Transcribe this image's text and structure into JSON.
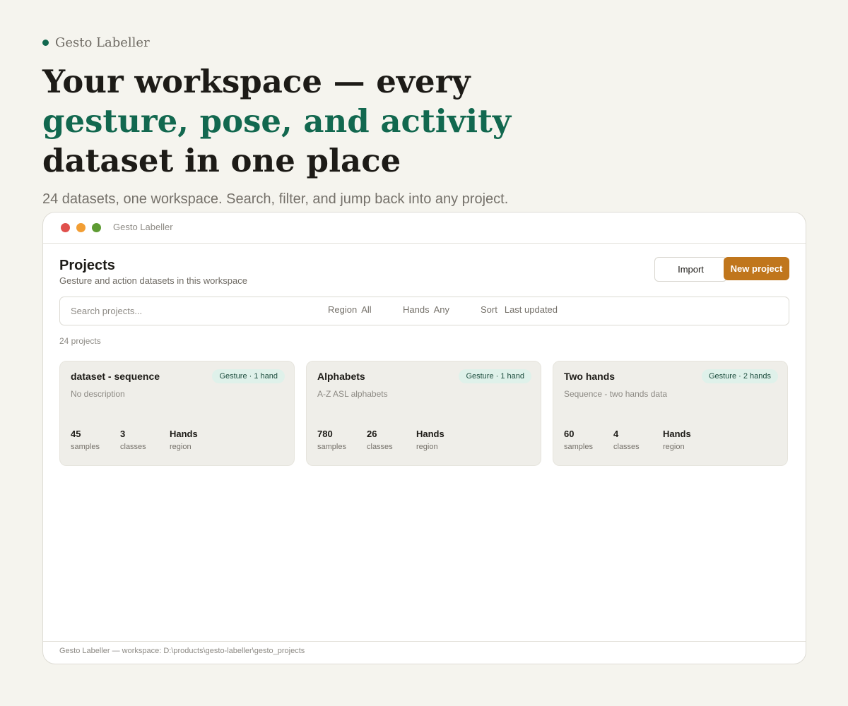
{
  "brand": {
    "name": "Gesto Labeller",
    "dot_color": "#12684f",
    "icon": "status-dot-icon"
  },
  "hero": {
    "title_line1": "Your workspace — every",
    "title_accent": "gesture, pose, and activity",
    "title_line3": "dataset in one place",
    "subtitle": "24 datasets, one workspace. Search, filter, and jump back into any project."
  },
  "window": {
    "title": "Gesto Labeller",
    "traffic_lights": [
      "#e0504c",
      "#f29e34",
      "#5e9b33"
    ]
  },
  "projects_page": {
    "title": "Projects",
    "subtitle": "Gesture and action datasets in this workspace",
    "import_label": "Import",
    "new_project_label": "New project",
    "accent_color": "#c0761c",
    "search_placeholder": "Search projects...",
    "filters": {
      "region": {
        "label": "Region",
        "value": "All"
      },
      "hands": {
        "label": "Hands",
        "value": "Any"
      },
      "sort": {
        "label": "Sort",
        "value": "Last updated"
      }
    },
    "count_text": "24 projects"
  },
  "cards": [
    {
      "title": "dataset - sequence",
      "badge": "Gesture · 1 hand",
      "description": "No description",
      "stats": [
        {
          "value": "45",
          "label": "samples"
        },
        {
          "value": "3",
          "label": "classes"
        },
        {
          "value": "Hands",
          "label": "region"
        }
      ]
    },
    {
      "title": "Alphabets",
      "badge": "Gesture · 1 hand",
      "description": "A-Z ASL alphabets",
      "stats": [
        {
          "value": "780",
          "label": "samples"
        },
        {
          "value": "26",
          "label": "classes"
        },
        {
          "value": "Hands",
          "label": "region"
        }
      ]
    },
    {
      "title": "Two hands",
      "badge": "Gesture · 2 hands",
      "description": "Sequence - two hands data",
      "stats": [
        {
          "value": "60",
          "label": "samples"
        },
        {
          "value": "4",
          "label": "classes"
        },
        {
          "value": "Hands",
          "label": "region"
        }
      ]
    }
  ],
  "footer": {
    "text": "Gesto Labeller — workspace: D:\\products\\gesto-labeller\\gesto_projects"
  }
}
